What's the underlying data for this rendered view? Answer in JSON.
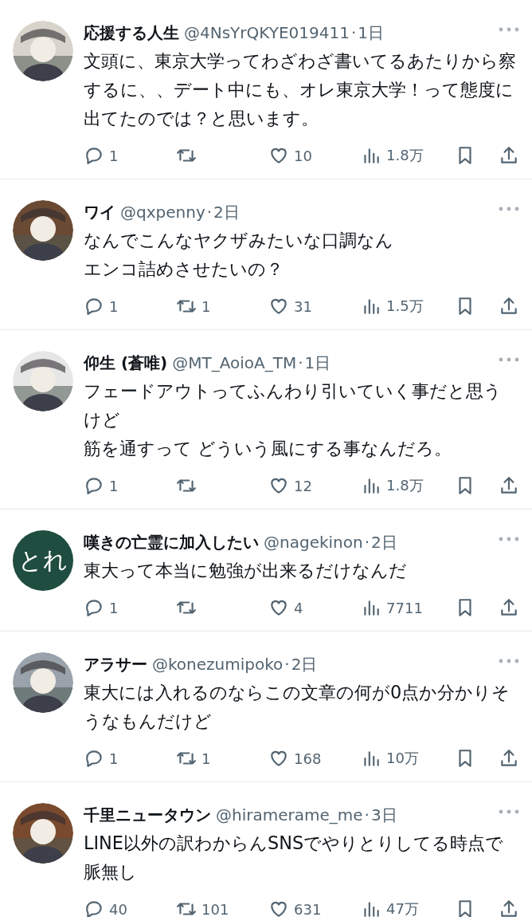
{
  "tweets": [
    {
      "avatar": {
        "kind": "picture"
      },
      "name": "応援する人生",
      "handle": "@4NsYrQKYE019411",
      "separator": "·",
      "time": "1日",
      "lines": [
        "文頭に、東京大学ってわざわざ書いてるあたりから察するに、、デート中にも、オレ東京大学！って態度に出てたのでは？と思います。"
      ],
      "replies": "1",
      "likes": "10",
      "views": "1.8万"
    },
    {
      "avatar": {
        "kind": "picture"
      },
      "name": "ワイ",
      "handle": "@qxpenny",
      "separator": "·",
      "time": "2日",
      "lines": [
        "なんでこんなヤクザみたいな口調なん",
        "エンコ詰めさせたいの？"
      ],
      "replies": "1",
      "reposts": "1",
      "likes": "31",
      "views": "1.5万"
    },
    {
      "avatar": {
        "kind": "picture"
      },
      "name": "仰生 (蒼唯)",
      "handle": "@MT_AoioA_TM",
      "separator": "·",
      "time": "1日",
      "lines": [
        "フェードアウトってふんわり引いていく事だと思うけど",
        "筋を通すって どういう風にする事なんだろ。"
      ],
      "replies": "1",
      "likes": "12",
      "views": "1.8万"
    },
    {
      "avatar": {
        "kind": "text",
        "label": "とれ",
        "color": "#1f4d3f"
      },
      "name": "嘆きの亡霊に加入したい",
      "handle": "@nagekinon",
      "separator": "·",
      "time": "2日",
      "lines": [
        "東大って本当に勉強が出来るだけなんだ"
      ],
      "replies": "1",
      "likes": "4",
      "views": "7711"
    },
    {
      "avatar": {
        "kind": "picture"
      },
      "name": "アラサー",
      "handle": "@konezumipoko",
      "separator": "·",
      "time": "2日",
      "lines": [
        "東大には入れるのならこの文章の何が0点か分かりそうなもんだけど"
      ],
      "replies": "1",
      "reposts": "1",
      "likes": "168",
      "views": "10万"
    },
    {
      "avatar": {
        "kind": "picture"
      },
      "name": "千里ニュータウン",
      "handle": "@hiramerame_me",
      "separator": "·",
      "time": "3日",
      "lines": [
        "LINE以外の訳わからんSNSでやりとりしてる時点で脈無し"
      ],
      "replies": "40",
      "reposts": "101",
      "likes": "631",
      "views": "47万"
    }
  ]
}
